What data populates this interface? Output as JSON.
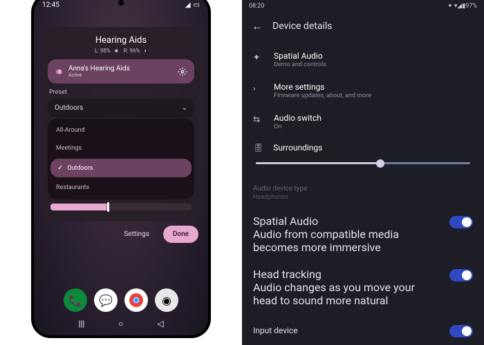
{
  "left": {
    "status": {
      "time": "12:45",
      "battery_icon": "▭"
    },
    "card": {
      "title": "Hearing Aids",
      "left_batt": "L: 98%",
      "right_batt": "R: 96%",
      "device_name": "Anna's Hearing Aids",
      "device_status": "Active",
      "preset_label": "Preset",
      "preset_selected": "Outdoors",
      "options": {
        "all_around": "All-Around",
        "meetings": "Meetings",
        "outdoors": "Outdoors",
        "restaurants": "Restaurants"
      },
      "settings_btn": "Settings",
      "done_btn": "Done"
    }
  },
  "right": {
    "status": {
      "time": "08:20",
      "batt": "97%"
    },
    "header": "Device details",
    "rows": {
      "spatial": {
        "t": "Spatial Audio",
        "s": "Demo and controls"
      },
      "more": {
        "t": "More settings",
        "s": "Firmware updates, about, and more"
      },
      "switch": {
        "t": "Audio switch",
        "s": "On"
      },
      "surround": "Surroundings"
    },
    "section": {
      "label": "Audio device type",
      "sub": "Headphones"
    },
    "toggles": {
      "spatial": {
        "t": "Spatial Audio",
        "s": "Audio from compatible media becomes more immersive"
      },
      "head": {
        "t": "Head tracking",
        "s": "Audio changes as you move your head to sound more natural"
      },
      "input": "Input device"
    }
  }
}
